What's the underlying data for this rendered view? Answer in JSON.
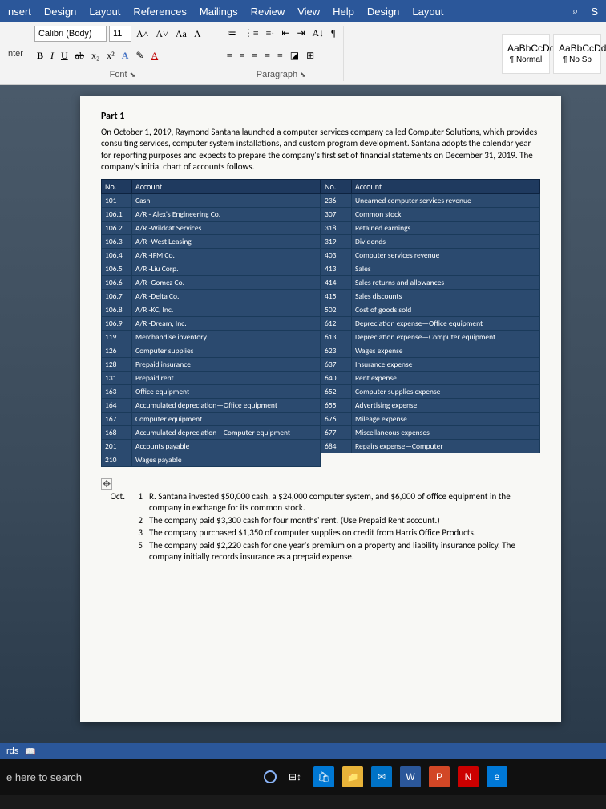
{
  "tabs": [
    "nsert",
    "Design",
    "Layout",
    "References",
    "Mailings",
    "Review",
    "View",
    "Help",
    "Design",
    "Layout"
  ],
  "search_icon": "⌕",
  "font": {
    "name": "Calibri (Body)",
    "size": "11"
  },
  "btn": {
    "grow": "A˄",
    "shrink": "A˅",
    "case": "Aa",
    "clear": "A⃠",
    "bold": "B",
    "italic": "I",
    "under": "U",
    "strike": "ab",
    "sub": "x₂",
    "sup": "x²",
    "txtfx": "A",
    "hilite": "✎",
    "color": "A"
  },
  "para": {
    "bul": "≔",
    "num": "⋮≡",
    "ml": "≡·",
    "dedent": "⇤",
    "indent": "⇥",
    "sort": "A↓",
    "marks": "¶",
    "al": "≡",
    "ac": "≡",
    "ar": "≡",
    "aj": "≡",
    "ls": "≡",
    "shade": "◪",
    "border": "⊞"
  },
  "group": {
    "font": "Font",
    "para": "Paragraph",
    "painter": "nter"
  },
  "styles": {
    "sample": "AaBbCcDd",
    "normal": "¶ Normal",
    "nospace": "¶ No Sp"
  },
  "part": "Part 1",
  "intro": "On October 1, 2019, Raymond Santana launched a computer services company called Computer Solutions, which provides consulting services, computer system installations, and custom program development. Santana adopts the calendar year for reporting purposes and expects to prepare the company's first set of financial statements on December 31, 2019. The company's initial chart of accounts follows.",
  "th": {
    "no": "No.",
    "acct": "Account"
  },
  "left": [
    {
      "n": "101",
      "a": "Cash"
    },
    {
      "n": "106.1",
      "a": "A/R - Alex's Engineering Co."
    },
    {
      "n": "106.2",
      "a": "A/R -Wildcat Services"
    },
    {
      "n": "106.3",
      "a": "A/R -West Leasing"
    },
    {
      "n": "106.4",
      "a": "A/R -IFM Co."
    },
    {
      "n": "106.5",
      "a": "A/R -Liu Corp."
    },
    {
      "n": "106.6",
      "a": "A/R -Gomez Co."
    },
    {
      "n": "106.7",
      "a": "A/R -Delta Co."
    },
    {
      "n": "106.8",
      "a": "A/R -KC, Inc."
    },
    {
      "n": "106.9",
      "a": "A/R -Dream, Inc."
    },
    {
      "n": "119",
      "a": "Merchandise inventory"
    },
    {
      "n": "126",
      "a": "Computer supplies"
    },
    {
      "n": "128",
      "a": "Prepaid insurance"
    },
    {
      "n": "131",
      "a": "Prepaid rent"
    },
    {
      "n": "163",
      "a": "Office equipment"
    },
    {
      "n": "164",
      "a": "Accumulated depreciation—Office equipment"
    },
    {
      "n": "167",
      "a": "Computer equipment"
    },
    {
      "n": "168",
      "a": "Accumulated depreciation—Computer equipment"
    },
    {
      "n": "201",
      "a": "Accounts payable"
    },
    {
      "n": "210",
      "a": "Wages payable"
    }
  ],
  "right": [
    {
      "n": "236",
      "a": "Unearned computer services revenue"
    },
    {
      "n": "307",
      "a": "Common stock"
    },
    {
      "n": "318",
      "a": "Retained earnings"
    },
    {
      "n": "319",
      "a": "Dividends"
    },
    {
      "n": "403",
      "a": "Computer services revenue"
    },
    {
      "n": "413",
      "a": "Sales"
    },
    {
      "n": "414",
      "a": "Sales returns and allowances"
    },
    {
      "n": "415",
      "a": "Sales discounts"
    },
    {
      "n": "502",
      "a": "Cost of goods sold"
    },
    {
      "n": "612",
      "a": "Depreciation expense—Office equipment"
    },
    {
      "n": "613",
      "a": "Depreciation expense—Computer equipment"
    },
    {
      "n": "623",
      "a": "Wages expense"
    },
    {
      "n": "637",
      "a": "Insurance expense"
    },
    {
      "n": "640",
      "a": "Rent expense"
    },
    {
      "n": "652",
      "a": "Computer supplies expense"
    },
    {
      "n": "655",
      "a": "Advertising expense"
    },
    {
      "n": "676",
      "a": "Mileage expense"
    },
    {
      "n": "677",
      "a": "Miscellaneous expenses"
    },
    {
      "n": "684",
      "a": "Repairs expense—Computer"
    }
  ],
  "move": "✥",
  "month": "Oct.",
  "entries": [
    {
      "n": "1",
      "t": "R. Santana invested $50,000 cash, a $24,000 computer system, and $6,000 of office equipment in the company in exchange for its common stock."
    },
    {
      "n": "2",
      "t": "The company paid $3,300 cash for four months' rent. (Use Prepaid Rent account.)"
    },
    {
      "n": "3",
      "t": "The company purchased $1,350 of computer supplies on credit from Harris Office Products."
    },
    {
      "n": "5",
      "t": "The company paid $2,220 cash for one year's premium on a property and liability insurance policy. The company initially records insurance as a prepaid expense."
    }
  ],
  "status": {
    "words": "rds",
    "book": "📖"
  },
  "search": "e here to search",
  "task": {
    "cortana": "O",
    "timeline": "⊟↕",
    "store": "🛍",
    "explorer": "📁",
    "mail": "✉",
    "word": "W",
    "ppt": "P",
    "n": "N",
    "edge": "e"
  }
}
